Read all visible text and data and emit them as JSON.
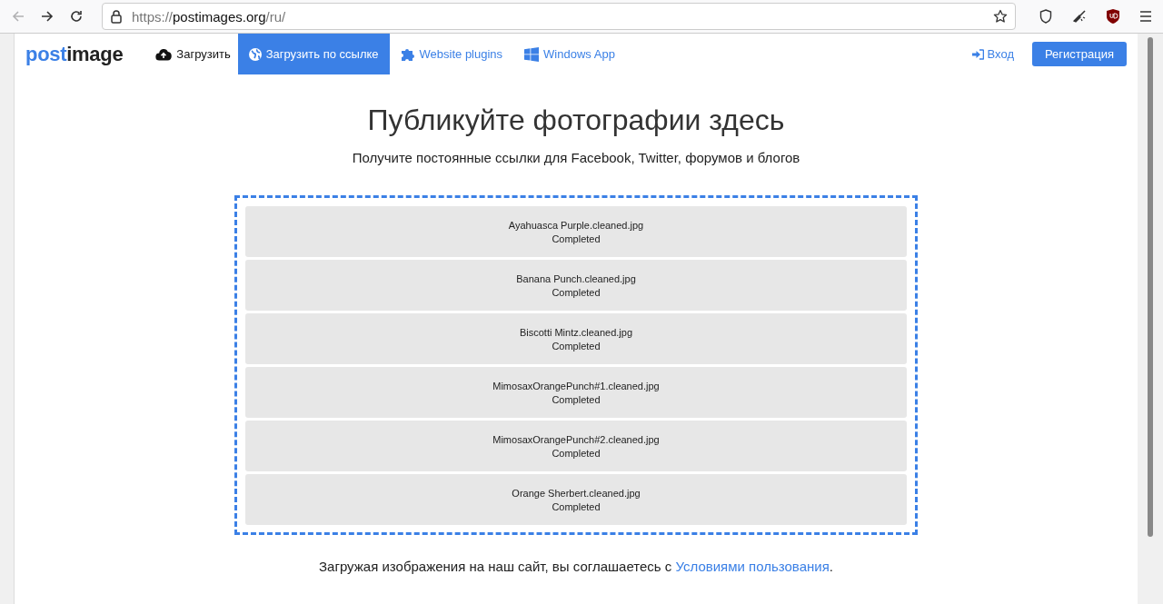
{
  "browser": {
    "url": [
      {
        "text": "https://",
        "kind": "dim"
      },
      {
        "text": "postimages.org",
        "kind": "host"
      },
      {
        "text": "/ru/",
        "kind": "dim"
      }
    ]
  },
  "navbar": {
    "logo": [
      "post",
      "image"
    ],
    "items": [
      {
        "label": "Загрузить",
        "kind": "upload",
        "selected": false
      },
      {
        "label": "Загрузить по ссылке",
        "kind": "globe",
        "selected": true
      },
      {
        "label": "Website plugins",
        "kind": "puzzle",
        "selected": false
      },
      {
        "label": "Windows App",
        "kind": "windows",
        "selected": false
      }
    ],
    "login": "Вход",
    "register": "Регистрация"
  },
  "title": "Публикуйте фотографии здесь",
  "subtitle": "Получите постоянные ссылки для Facebook, Twitter, форумов и блогов",
  "uploads": [
    {
      "name": "Ayahuasca Purple.cleaned.jpg",
      "status": "Completed"
    },
    {
      "name": "Banana Punch.cleaned.jpg",
      "status": "Completed"
    },
    {
      "name": "Biscotti Mintz.cleaned.jpg",
      "status": "Completed"
    },
    {
      "name": "MimosaxOrangePunch#1.cleaned.jpg",
      "status": "Completed"
    },
    {
      "name": "MimosaxOrangePunch#2.cleaned.jpg",
      "status": "Completed"
    },
    {
      "name": "Orange Sherbert.cleaned.jpg",
      "status": "Completed"
    }
  ],
  "terms": {
    "text": "Загружая изображения на наш сайт, вы соглашаетесь с",
    "link": "Условиями пользования",
    "end": "."
  }
}
